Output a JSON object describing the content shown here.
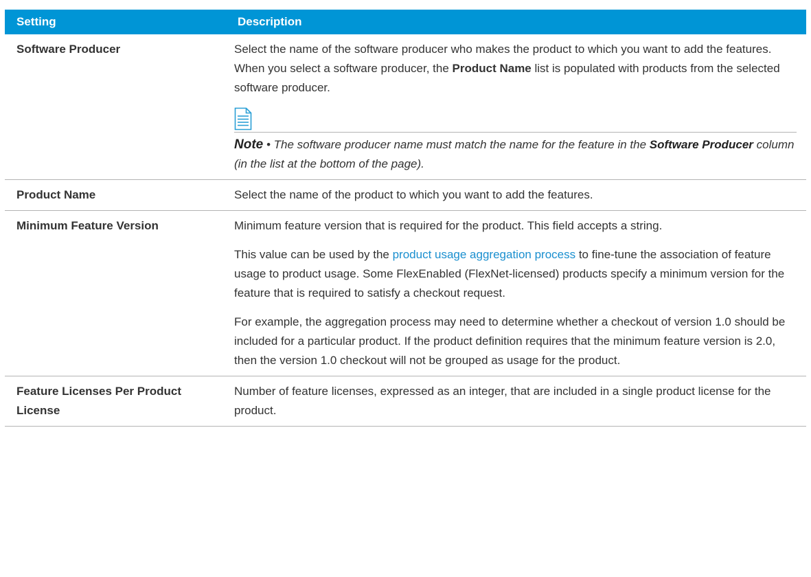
{
  "table": {
    "headers": {
      "setting": "Setting",
      "description": "Description"
    },
    "rows": [
      {
        "setting": "Software Producer",
        "desc_before": "Select the name of the software producer who makes the product to which you want to add the features. When you select a software producer, the ",
        "desc_bold": "Product Name",
        "desc_after": " list is populated with products from the selected software producer.",
        "note": {
          "icon": "note-document-icon",
          "label": "Note",
          "separator": " • ",
          "text_before": "The software producer name must match the name for the feature in the ",
          "text_bold": "Software Producer",
          "text_after": " column (in the list at the bottom of the page)."
        }
      },
      {
        "setting": "Product Name",
        "desc": "Select the name of the product to which you want to add the features."
      },
      {
        "setting": "Minimum Feature Version",
        "desc_p1": "Minimum feature version that is required for the product. This field accepts a string.",
        "desc_p2_before": "This value can be used by the ",
        "desc_p2_link": "product usage aggregation process",
        "desc_p2_after": " to fine-tune the association of feature usage to product usage. Some FlexEnabled (FlexNet-licensed) products specify a minimum version for the feature that is required to satisfy a checkout request.",
        "desc_p3": "For example, the aggregation process may need to determine whether a checkout of version 1.0 should be included for a particular product. If the product definition requires that the minimum feature version is 2.0, then the version 1.0 checkout will not be grouped as usage for the product."
      },
      {
        "setting": "Feature Licenses Per Product License",
        "desc": "Number of feature licenses, expressed as an integer, that are included in a single product license for the product."
      }
    ]
  },
  "colors": {
    "header_bg": "#0095d6",
    "header_text": "#ffffff",
    "link": "#1a8fcf",
    "rule": "#b3b3b3"
  }
}
